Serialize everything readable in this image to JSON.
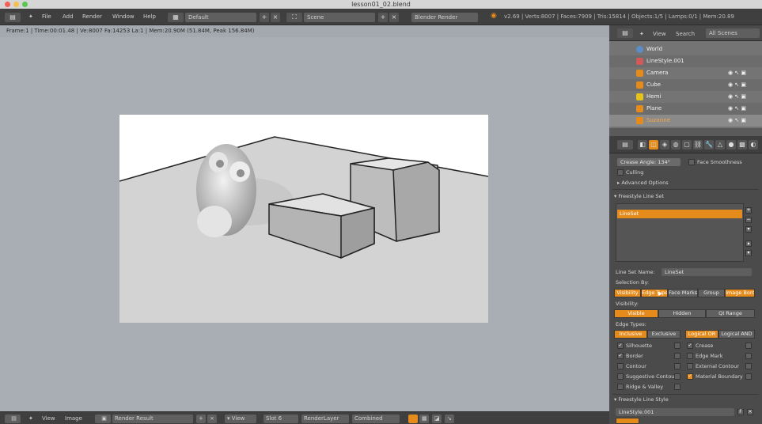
{
  "window": {
    "title": "lesson01_02.blend"
  },
  "top_menu": {
    "items": [
      "File",
      "Add",
      "Render",
      "Window",
      "Help"
    ],
    "layout": "Default",
    "scene": "Scene",
    "engine": "Blender Render",
    "stats": "v2.69 | Verts:8007 | Faces:7909 | Tris:15814 | Objects:1/5 | Lamps:0/1 | Mem:20.89"
  },
  "viewport": {
    "header": "Frame:1 | Time:00:01.48 | Ve:8007 Fa:14253 La:1 | Mem:20.90M (51.84M, Peak 156.84M)"
  },
  "outliner": {
    "view_label": "View",
    "search_label": "Search",
    "filter": "All Scenes",
    "rows": [
      {
        "label": "World"
      },
      {
        "label": "LineStyle.001"
      },
      {
        "label": "Camera"
      },
      {
        "label": "Cube"
      },
      {
        "label": "Hemi"
      },
      {
        "label": "Plane"
      },
      {
        "label": "Suzanne"
      }
    ]
  },
  "properties": {
    "crease_angle": "Crease Angle: 134°",
    "face_smoothness": "Face Smoothness",
    "culling": "Culling",
    "advanced_options": "Advanced Options",
    "lineset_panel": "Freestyle Line Set",
    "lineset_name": "LineSet",
    "render_set_label": "Line Set Name:",
    "render_set_value": "LineSet",
    "selection_by": "Selection By:",
    "selection_buttons": [
      "Visibility",
      "Edge Types",
      "Face Marks",
      "Group",
      "Image Border"
    ],
    "visibility_label": "Visibility:",
    "visibility_buttons": [
      "Visible",
      "Hidden",
      "QI Range"
    ],
    "edge_types_label": "Edge Types:",
    "edge_mode_buttons": [
      "Inclusive",
      "Exclusive",
      "Logical OR",
      "Logical AND"
    ],
    "edge_types_left": [
      "Silhouette",
      "Border",
      "Contour",
      "Suggestive Contour",
      "Ridge & Valley"
    ],
    "edge_types_right": [
      "Crease",
      "Edge Mark",
      "External Contour",
      "Material Boundary"
    ],
    "linestyle_panel": "Freestyle Line Style",
    "linestyle_name": "LineStyle.001"
  },
  "bottom_bar": {
    "view": "View",
    "image": "Image",
    "image_name": "Render Result",
    "view2": "View",
    "slot": "Slot 6",
    "layer": "RenderLayer",
    "pass": "Combined"
  },
  "colors": {
    "accent": "#e58b1c",
    "viewport_bg": "#a9aeb4",
    "panel_bg": "#4b4b4b"
  }
}
